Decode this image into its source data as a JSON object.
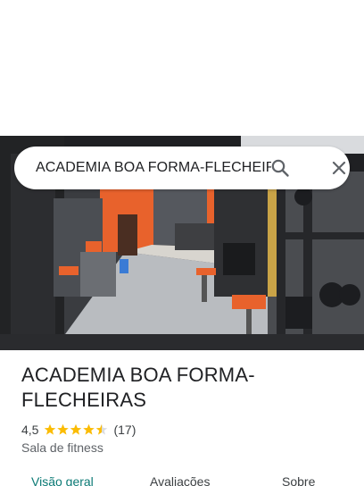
{
  "search": {
    "query": "ACADEMIA BOA FORMA-FLECHEIRAS",
    "search_icon": "search-icon",
    "close_icon": "close-icon"
  },
  "place": {
    "name": "ACADEMIA BOA FORMA-FLECHEIRAS",
    "rating": "4,5",
    "rating_value": 4.5,
    "rating_max": 5,
    "review_count": "(17)",
    "category": "Sala de fitness",
    "star_color": "#fbbc04"
  },
  "tabs": [
    {
      "label": "Visão geral",
      "active": true
    },
    {
      "label": "Avaliações",
      "active": false
    },
    {
      "label": "Sobre",
      "active": false
    }
  ],
  "colors": {
    "active_tab": "#0b7a75",
    "wall_accent": "#e8622c"
  }
}
